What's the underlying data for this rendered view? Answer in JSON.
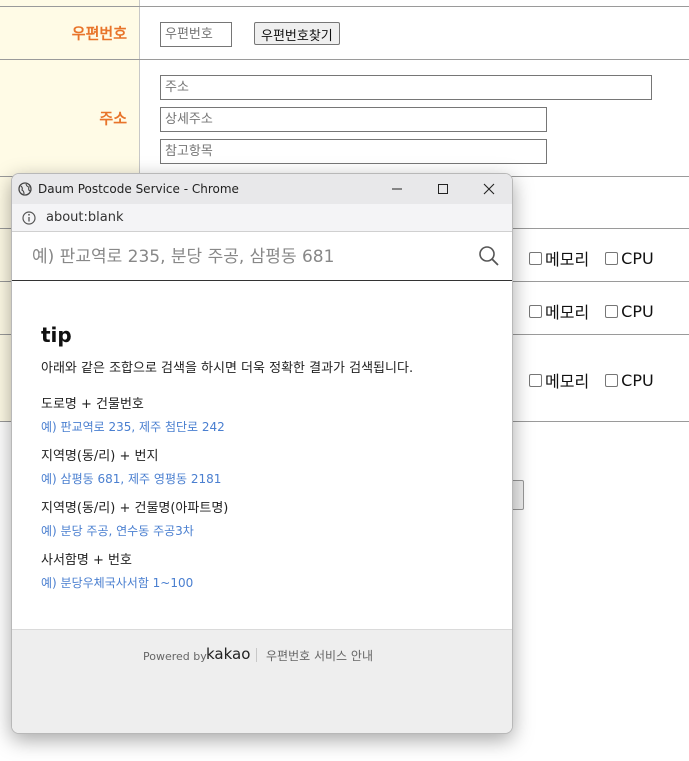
{
  "form": {
    "zipcode_label": "우편번호",
    "zipcode_placeholder": "우편번호",
    "zipcode_button": "우편번호찾기",
    "address_label": "주소",
    "address_placeholder": "주소",
    "detail_address_placeholder": "상세주소",
    "extra_address_placeholder": "참고항목",
    "options": [
      {
        "memory": "메모리",
        "cpu": "CPU"
      },
      {
        "memory": "메모리",
        "cpu": "CPU"
      },
      {
        "memory": "메모리",
        "cpu": "CPU"
      }
    ]
  },
  "popup": {
    "window_title": "Daum Postcode Service - Chrome",
    "url": "about:blank",
    "search_placeholder": "예) 판교역로 235, 분당 주공, 삼평동 681",
    "tip_title": "tip",
    "tip_desc": "아래와 같은 조합으로 검색을 하시면 더욱 정확한 결과가 검색됩니다.",
    "tips": [
      {
        "heading": "도로명 + 건물번호",
        "example": "예) 판교역로 235,  제주 첨단로 242"
      },
      {
        "heading": "지역명(동/리) + 번지",
        "example": "예) 삼평동 681,  제주 영평동 2181"
      },
      {
        "heading": "지역명(동/리) + 건물명(아파트명)",
        "example": "예) 분당 주공,  연수동 주공3차"
      },
      {
        "heading": "사서함명 + 번호",
        "example": "예) 분당우체국사서함 1~100"
      }
    ],
    "footer": {
      "powered_by": "Powered by",
      "brand": "kakao",
      "guide_link": "우편번호 서비스 안내"
    }
  },
  "colors": {
    "label_orange": "#e8742a",
    "label_bg": "#fffbe6",
    "link_blue": "#4a7fd0"
  }
}
